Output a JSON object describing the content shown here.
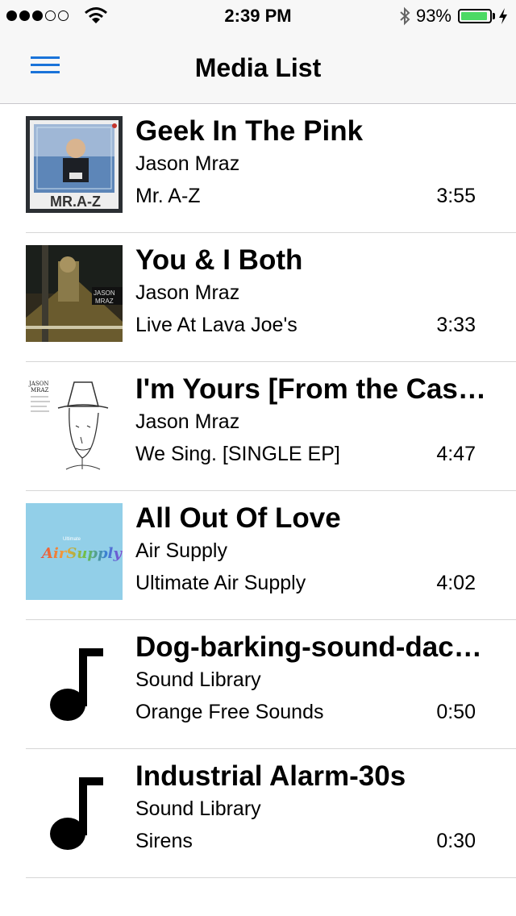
{
  "status_bar": {
    "time": "2:39 PM",
    "battery_percent": "93%",
    "battery_level": 0.93,
    "signal_bars_filled": 3,
    "signal_bars_total": 5
  },
  "nav": {
    "title": "Media List",
    "menu_icon": "hamburger-menu-icon",
    "accent_color": "#1a73d9"
  },
  "media_items": [
    {
      "title": "Geek In The Pink",
      "artist": "Jason Mraz",
      "album": "Mr. A-Z",
      "duration": "3:55",
      "artwork": "album-art",
      "art_text": "MR.A-Z"
    },
    {
      "title": "You & I Both",
      "artist": "Jason Mraz",
      "album": "Live At Lava Joe's",
      "duration": "3:33",
      "artwork": "album-art",
      "art_text": "JASON MRAZ"
    },
    {
      "title": "I'm Yours [From the Casino Stage]",
      "artist": "Jason Mraz",
      "album": "We Sing. [SINGLE EP]",
      "duration": "4:47",
      "artwork": "album-art",
      "art_text": "JASON MRAZ"
    },
    {
      "title": "All Out Of Love",
      "artist": "Air Supply",
      "album": "Ultimate Air Supply",
      "duration": "4:02",
      "artwork": "album-art",
      "art_text": "Ultimate Air Supply"
    },
    {
      "title": "Dog-barking-sound-dachshund",
      "artist": "Sound Library",
      "album": "Orange Free Sounds",
      "duration": "0:50",
      "artwork": "music-note-icon"
    },
    {
      "title": "Industrial Alarm-30s",
      "artist": "Sound Library",
      "album": "Sirens",
      "duration": "0:30",
      "artwork": "music-note-icon"
    }
  ]
}
